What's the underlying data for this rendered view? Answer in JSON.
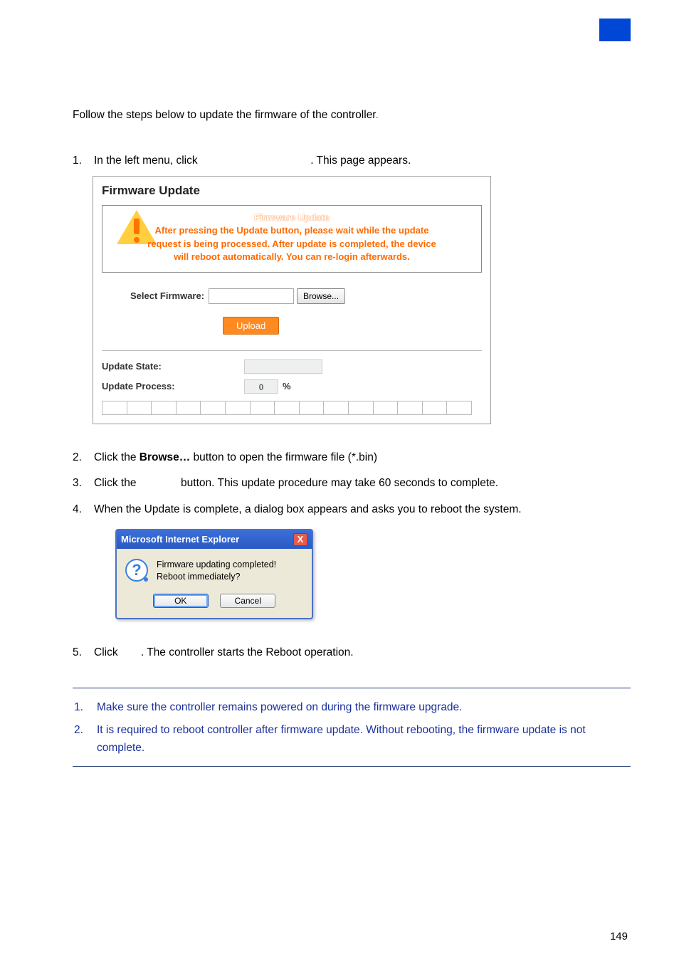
{
  "intro": "Follow the steps below to update the firmware of the controller",
  "intro_period": ".",
  "steps": {
    "s1_num": "1.",
    "s1_a": "In the left menu, click ",
    "s1_b": ". This page appears.",
    "s2_num": "2.",
    "s2_a": "Click the ",
    "s2_bold": "Browse…",
    "s2_b": " button to open the firmware file (*.bin)",
    "s3_num": "3.",
    "s3_a": "Click the ",
    "s3_b": " button. This update procedure may take 60 seconds to complete.",
    "s4_num": "4.",
    "s4": "When the Update is complete, a dialog box appears and asks you to reboot the system.",
    "s5_num": "5.",
    "s5_a": "Click ",
    "s5_b": ". The controller starts the Reboot operation."
  },
  "panel": {
    "title": "Firmware Update",
    "warn_heading": "Firmware Update",
    "warn_l1": "After pressing the Update button, please wait while the update",
    "warn_l2": "request is being processed. After update is completed, the device",
    "warn_l3": "will reboot automatically. You can re-login afterwards.",
    "select_label": "Select Firmware:",
    "browse": "Browse...",
    "upload": "Upload",
    "state_label": "Update State:",
    "process_label": "Update Process:",
    "pct_value": "0",
    "pct_sign": "%"
  },
  "dialog": {
    "title": "Microsoft Internet Explorer",
    "close": "X",
    "line1": "Firmware updating completed!",
    "line2": "Reboot immediately?",
    "ok": "OK",
    "cancel": "Cancel",
    "qmark": "?"
  },
  "notes": {
    "n1_num": "1.",
    "n1": "Make sure the controller remains powered on during the firmware upgrade.",
    "n2_num": "2.",
    "n2": "It is required to reboot controller after firmware update. Without rebooting, the firmware update is not complete."
  },
  "page_number": "149"
}
